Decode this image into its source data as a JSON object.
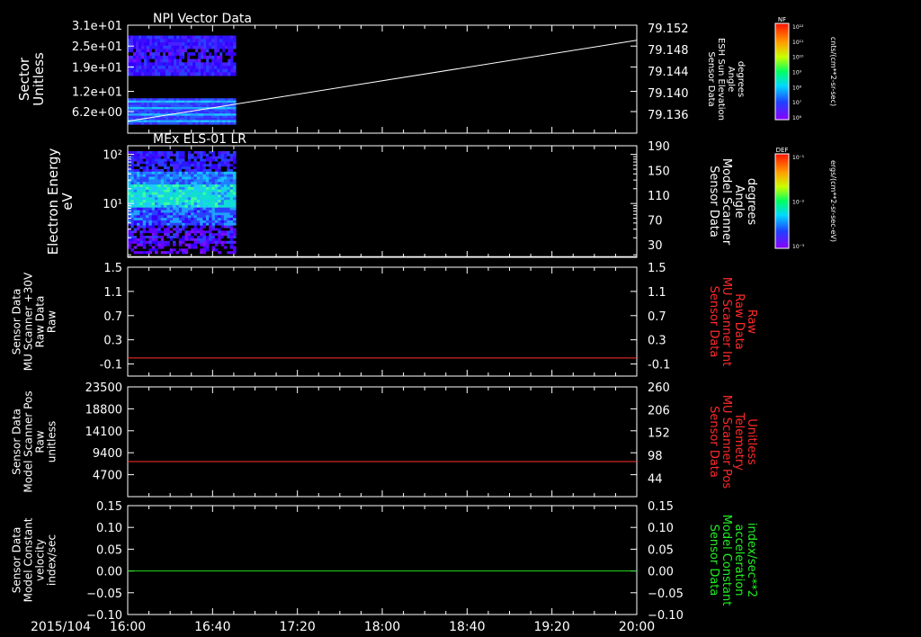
{
  "chart_data": [
    {
      "type": "heatmap",
      "title": "NPI Vector Data",
      "ylabel": [
        "Sector",
        "Unitless"
      ],
      "yticks": [
        "3.1e+01",
        "2.5e+01",
        "1.9e+01",
        "1.2e+01",
        "6.2e+00"
      ],
      "ylim": [
        0,
        31
      ],
      "data_x_range": [
        "16:00",
        "16:51"
      ],
      "heat_rows": [
        {
          "y_from": 16.5,
          "y_to": 28.0,
          "level": "high"
        },
        {
          "y_from": 2.5,
          "y_to": 10.0,
          "level": "medium"
        }
      ],
      "right_axis": {
        "label": [
          "Sensor Data",
          "ESH Sun Elevation",
          "Angle",
          "degrees"
        ],
        "ticks": [
          "79.152",
          "79.148",
          "79.144",
          "79.140",
          "79.136"
        ],
        "ylim": [
          79.1325,
          79.1525
        ]
      },
      "line_series": {
        "color": "#ffffff",
        "x": [
          "16:00",
          "20:00"
        ],
        "y": [
          79.1347,
          79.1497
        ]
      },
      "colorbar": {
        "name": "NF",
        "units": "cnts/(cm**2-sr-sec)",
        "ticks": [
          "10¹²",
          "10¹¹",
          "10¹⁰",
          "10⁹",
          "10⁸",
          "10⁷",
          "10⁶"
        ]
      }
    },
    {
      "type": "heatmap",
      "title": "MEx ELS-01 LR",
      "ylabel": [
        "Electron Energy",
        "eV"
      ],
      "yticks": [
        "10²",
        "10¹"
      ],
      "yscale": "log",
      "ylim": [
        0.8,
        150
      ],
      "data_x_range": [
        "16:00",
        "16:51"
      ],
      "right_axis": {
        "label": [
          "Sensor Data",
          "Model Scanner",
          "Angle",
          "degrees"
        ],
        "ticks": [
          "190",
          "150",
          "110",
          "70",
          "30"
        ],
        "ylim": [
          10,
          190
        ]
      },
      "line_series": {
        "color": "#ffffff",
        "x": [
          "16:00",
          "20:00"
        ],
        "y": [
          11,
          11
        ]
      },
      "colorbar": {
        "name": "DEF",
        "units": "ergs/(cm**2-sr-sec-eV)",
        "ticks": [
          "10⁻¹",
          "10⁻²",
          "10⁻³"
        ]
      }
    },
    {
      "type": "line",
      "ylabel": [
        "Sensor Data",
        "MU Scanner +30V",
        "Raw Data",
        "Raw"
      ],
      "yticks": [
        "1.5",
        "1.1",
        "0.7",
        "0.3",
        "-0.1"
      ],
      "ylim": [
        -0.3,
        1.5
      ],
      "right_axis": {
        "label": [
          "Sensor Data",
          "MU Scanner Int",
          "Raw Data",
          "Raw"
        ],
        "label_color": "#ff2a2a",
        "ticks": [
          "1.5",
          "1.1",
          "0.7",
          "0.3",
          "-0.1"
        ],
        "ylim": [
          -0.3,
          1.5
        ]
      },
      "series": [
        {
          "color": "#ff3030",
          "x": [
            "16:00",
            "20:00"
          ],
          "y": [
            0.0,
            0.0
          ]
        }
      ]
    },
    {
      "type": "line",
      "ylabel": [
        "Sensor Data",
        "Model Scanner Pos",
        "Raw",
        "unitless"
      ],
      "yticks": [
        "23500",
        "18800",
        "14100",
        "9400",
        "4700"
      ],
      "ylim": [
        0,
        23500
      ],
      "right_axis": {
        "label": [
          "Sensor Data",
          "MU Scanner Pos",
          "Telemetry",
          "Unitless"
        ],
        "label_color": "#ff2a2a",
        "ticks": [
          "260",
          "206",
          "152",
          "98",
          "44"
        ],
        "ylim": [
          0,
          260
        ]
      },
      "series": [
        {
          "color": "#ff3030",
          "x": [
            "16:00",
            "20:00"
          ],
          "y": [
            7520,
            7520
          ]
        }
      ]
    },
    {
      "type": "line",
      "ylabel": [
        "Sensor Data",
        "Model Constant",
        "velocity",
        "index/sec"
      ],
      "yticks": [
        "0.15",
        "0.10",
        "0.05",
        "0.00",
        "−0.05",
        "−0.10"
      ],
      "ylim": [
        -0.1,
        0.15
      ],
      "right_axis": {
        "label": [
          "Sensor Data",
          "Model Constant",
          "acceleration",
          "index/sec**2"
        ],
        "label_color": "#22ee22",
        "ticks": [
          "0.15",
          "0.10",
          "0.05",
          "0.00",
          "−0.05",
          "−0.10"
        ],
        "ylim": [
          -0.1,
          0.15
        ]
      },
      "series": [
        {
          "color": "#22dd22",
          "x": [
            "16:00",
            "20:00"
          ],
          "y": [
            0.0,
            0.0
          ]
        }
      ]
    }
  ],
  "xaxis": {
    "date_label": "2015/104",
    "ticks": [
      "16:00",
      "16:40",
      "17:20",
      "18:00",
      "18:40",
      "19:20",
      "20:00"
    ],
    "xlim": [
      "16:00",
      "20:00"
    ]
  }
}
